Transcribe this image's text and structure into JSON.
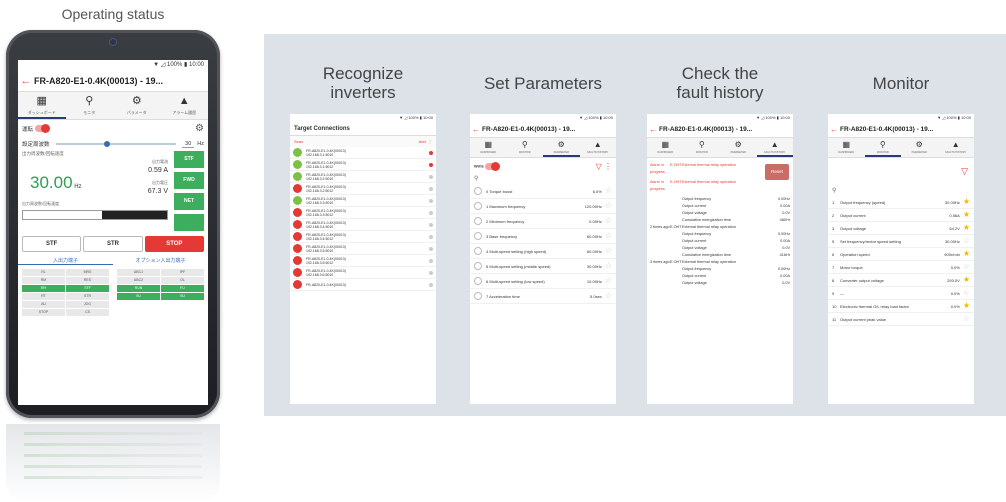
{
  "phone": {
    "caption": "Operating status",
    "status": "▼ ◿ 100% ▮ 10:00",
    "title": "FR-A820-E1-0.4K(00013) - 19...",
    "nav": [
      {
        "icon": "▦",
        "label": "ダッシュボード",
        "icon_name": "dashboard-icon"
      },
      {
        "icon": "⚲",
        "label": "モニタ",
        "icon_name": "monitor-icon"
      },
      {
        "icon": "⚙",
        "label": "パラメータ",
        "icon_name": "parameter-icon"
      },
      {
        "icon": "▲",
        "label": "アラーム履歴",
        "icon_name": "alarm-icon"
      }
    ],
    "run_label": "運転",
    "freq_label": "設定周波数",
    "freq_value": "30",
    "freq_unit": "Hz",
    "out_label": "出力周波数/回転速度",
    "out_value": "30.00",
    "out_unit": "Hz",
    "current_label": "出力電流",
    "current_value": "0.59 A",
    "voltage_label": "出力電圧",
    "voltage_value": "67.3 V",
    "speed_label": "出力周波数/回転速度",
    "side_buttons": [
      "STF",
      "FWD",
      "NET",
      ""
    ],
    "buttons": {
      "stf": "STF",
      "str": "STR",
      "stop": "STOP"
    },
    "tab_in": "入出力端子",
    "tab_opt": "オプション入出力端子",
    "terminals_left": [
      "RL",
      "MRS",
      "RM",
      "RES",
      "RH",
      "STF",
      "RT",
      "STR",
      "AU",
      "JOG",
      "STOP",
      "CS"
    ],
    "terminals_right": [
      "ABC1",
      "IPF",
      "ABC2",
      "OL",
      "RUN",
      "FU",
      "SU",
      "SU"
    ],
    "terminals_on_left": [
      4,
      5
    ],
    "terminals_on_right": [
      4,
      5,
      6,
      7
    ]
  },
  "features": [
    {
      "label": "Recognize\ninverters"
    },
    {
      "label": "Set Parameters"
    },
    {
      "label": "Check the\nfault history"
    },
    {
      "label": "Monitor"
    }
  ],
  "screen1": {
    "status": "▼ ◿ 100% ▮ 10:00",
    "title": "Target Connections",
    "scan": "Scan",
    "add": "Add",
    "rows": [
      {
        "color": "g",
        "line1": "FR-A820-E1-0.4K(00013)",
        "line2": "192.168.3.1:5010",
        "pin": "red"
      },
      {
        "color": "g",
        "line1": "FR-A820-E1-0.4K(00013)",
        "line2": "192.168.3.1:5012",
        "pin": "red"
      },
      {
        "color": "g",
        "line1": "FR-A820-E1-0.4K(00013)",
        "line2": "192.168.3.2:5010",
        "pin": ""
      },
      {
        "color": "r",
        "line1": "FR-A820-E1-0.4K(00013)",
        "line2": "192.168.3.2:5012",
        "pin": ""
      },
      {
        "color": "g",
        "line1": "FR-A820-E1-0.4K(00013)",
        "line2": "192.168.3.3:5010",
        "pin": ""
      },
      {
        "color": "r",
        "line1": "FR-A820-E1-0.4K(00013)",
        "line2": "192.168.3.3:5012",
        "pin": ""
      },
      {
        "color": "r",
        "line1": "FR-A820-E1-0.4K(00013)",
        "line2": "192.168.3.4:5010",
        "pin": ""
      },
      {
        "color": "r",
        "line1": "FR-A820-E1-0.4K(00013)",
        "line2": "192.168.3.4:5012",
        "pin": ""
      },
      {
        "color": "r",
        "line1": "FR-A820-E1-0.4K(00013)",
        "line2": "192.168.3.5:5010",
        "pin": ""
      },
      {
        "color": "r",
        "line1": "FR-A820-E1-0.4K(00013)",
        "line2": "192.168.3.5:5012",
        "pin": ""
      },
      {
        "color": "r",
        "line1": "FR-A820-E1-0.4K(00013)",
        "line2": "192.168.3.6:5010",
        "pin": ""
      },
      {
        "color": "r",
        "line1": "FR-A820-E1-0.4K(00013)",
        "line2": "",
        "pin": ""
      }
    ]
  },
  "screen2": {
    "status": "▼ ◿ 100% ▮ 10:00",
    "title": "FR-A820-E1-0.4K(00013) - 19...",
    "write_label": "Write",
    "nav": [
      {
        "icon": "▦",
        "label": "DASHBOARD"
      },
      {
        "icon": "⚲",
        "label": "MONITOR"
      },
      {
        "icon": "⚙",
        "label": "PARAMETER"
      },
      {
        "icon": "▲",
        "label": "FAULTS HISTORY"
      }
    ],
    "params": [
      {
        "name": "0  Torque boost",
        "value": "6.0%"
      },
      {
        "name": "1  Maximum frequency",
        "value": "120.00Hz"
      },
      {
        "name": "2  Minimum frequency",
        "value": "0.00Hz"
      },
      {
        "name": "3  Base frequency",
        "value": "60.00Hz"
      },
      {
        "name": "4  Multi-speed setting (high speed)",
        "value": "60.00Hz"
      },
      {
        "name": "5  Multi-speed setting (middle speed)",
        "value": "30.00Hz"
      },
      {
        "name": "6  Multi-speed setting (low speed)",
        "value": "10.00Hz"
      },
      {
        "name": "7  Acceleration time",
        "value": "5.0sec"
      }
    ]
  },
  "screen3": {
    "status": "▼ ◿ 100% ▮ 10:00",
    "title": "FR-A820-E1-0.4K(00013) - 19...",
    "nav": [
      {
        "icon": "▦",
        "label": "DASHBOARD"
      },
      {
        "icon": "⚲",
        "label": "MONITOR"
      },
      {
        "icon": "⚙",
        "label": "PARAMETER"
      },
      {
        "icon": "▲",
        "label": "FAULTS HISTORY"
      }
    ],
    "reset": "Reset",
    "alarms": [
      {
        "when": "Alarm in progress",
        "code": "E.OHT",
        "desc": "External thermal relay operation"
      },
      {
        "when": "Alarm in progress",
        "code": "E.OHT",
        "desc": "External thermal relay operation"
      }
    ],
    "history": [
      {
        "when": "",
        "code": "",
        "desc": "Output frequency",
        "val": "0.00Hz"
      },
      {
        "when": "",
        "code": "",
        "desc": "Output current",
        "val": "0.00A"
      },
      {
        "when": "",
        "code": "",
        "desc": "Output voltage",
        "val": "0.0V"
      },
      {
        "when": "",
        "code": "",
        "desc": "Cumulative energization time",
        "val": "480Hr"
      },
      {
        "when": "2 times ago",
        "code": "E.OHT",
        "desc": "External thermal relay operation",
        "val": ""
      },
      {
        "when": "",
        "code": "",
        "desc": "Output frequency",
        "val": "0.00Hz"
      },
      {
        "when": "",
        "code": "",
        "desc": "Output current",
        "val": "0.00A"
      },
      {
        "when": "",
        "code": "",
        "desc": "Output voltage",
        "val": "0.0V"
      },
      {
        "when": "",
        "code": "",
        "desc": "Cumulative energization time",
        "val": "416Hr"
      },
      {
        "when": "3 times ago",
        "code": "E.OHT",
        "desc": "External thermal relay operation",
        "val": ""
      },
      {
        "when": "",
        "code": "",
        "desc": "Output frequency",
        "val": "0.00Hz"
      },
      {
        "when": "",
        "code": "",
        "desc": "Output current",
        "val": "0.00A"
      },
      {
        "when": "",
        "code": "",
        "desc": "Output voltage",
        "val": "0.0V"
      }
    ]
  },
  "screen4": {
    "status": "▼ ◿ 100% ▮ 10:00",
    "title": "FR-A820-E1-0.4K(00013) - 19...",
    "nav": [
      {
        "icon": "▦",
        "label": "DASHBOARD"
      },
      {
        "icon": "⚲",
        "label": "MONITOR"
      },
      {
        "icon": "⚙",
        "label": "PARAMETER"
      },
      {
        "icon": "▲",
        "label": "FAULTS HISTORY"
      }
    ],
    "monitors": [
      {
        "no": "1",
        "name": "Output frequency (speed)",
        "value": "30.00Hz",
        "star": true
      },
      {
        "no": "2",
        "name": "Output current",
        "value": "0.56A",
        "star": true
      },
      {
        "no": "3",
        "name": "Output voltage",
        "value": "64.2V",
        "star": true
      },
      {
        "no": "5",
        "name": "Set frequency/motor speed setting",
        "value": "30.00Hz",
        "star": false
      },
      {
        "no": "6",
        "name": "Operation speed",
        "value": "900r/min",
        "star": true
      },
      {
        "no": "7",
        "name": "Motor torque",
        "value": "0.0%",
        "star": false
      },
      {
        "no": "8",
        "name": "Converter output voltage",
        "value": "293.0V",
        "star": true
      },
      {
        "no": "9",
        "name": "—",
        "value": "0.0%",
        "star": false
      },
      {
        "no": "10",
        "name": "Electronic thermal O/L relay load factor",
        "value": "0.0%",
        "star": true
      },
      {
        "no": "11",
        "name": "Output current peak value",
        "value": "",
        "star": false
      }
    ]
  }
}
